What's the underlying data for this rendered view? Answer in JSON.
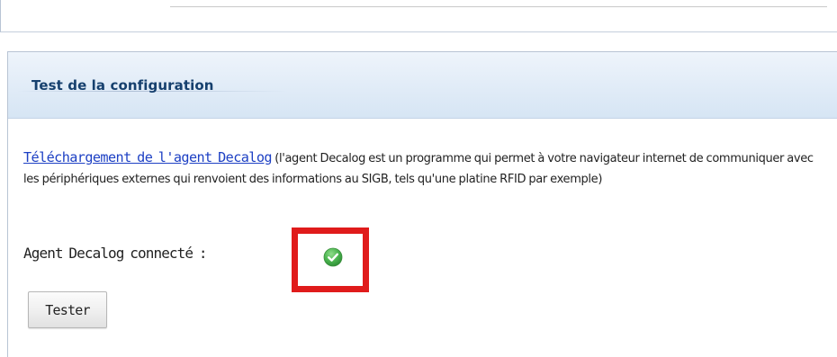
{
  "section": {
    "title": "Test de la configuration"
  },
  "description": {
    "link_text": "Téléchargement de l'agent Decalog",
    "text": " (l'agent Decalog est un programme qui permet à votre navigateur internet de communiquer avec les périphériques externes qui renvoient des informations au SIGB, tels qu'une platine RFID par exemple)"
  },
  "status": {
    "label": "Agent Decalog connecté :",
    "icon": "check-circle-icon",
    "state": "connected",
    "color": "#3fae49"
  },
  "actions": {
    "tester_label": "Tester"
  },
  "colors": {
    "header_bg": "#dde9f6",
    "title": "#16406e",
    "link": "#1d40c4",
    "highlight": "#e01b1b"
  }
}
